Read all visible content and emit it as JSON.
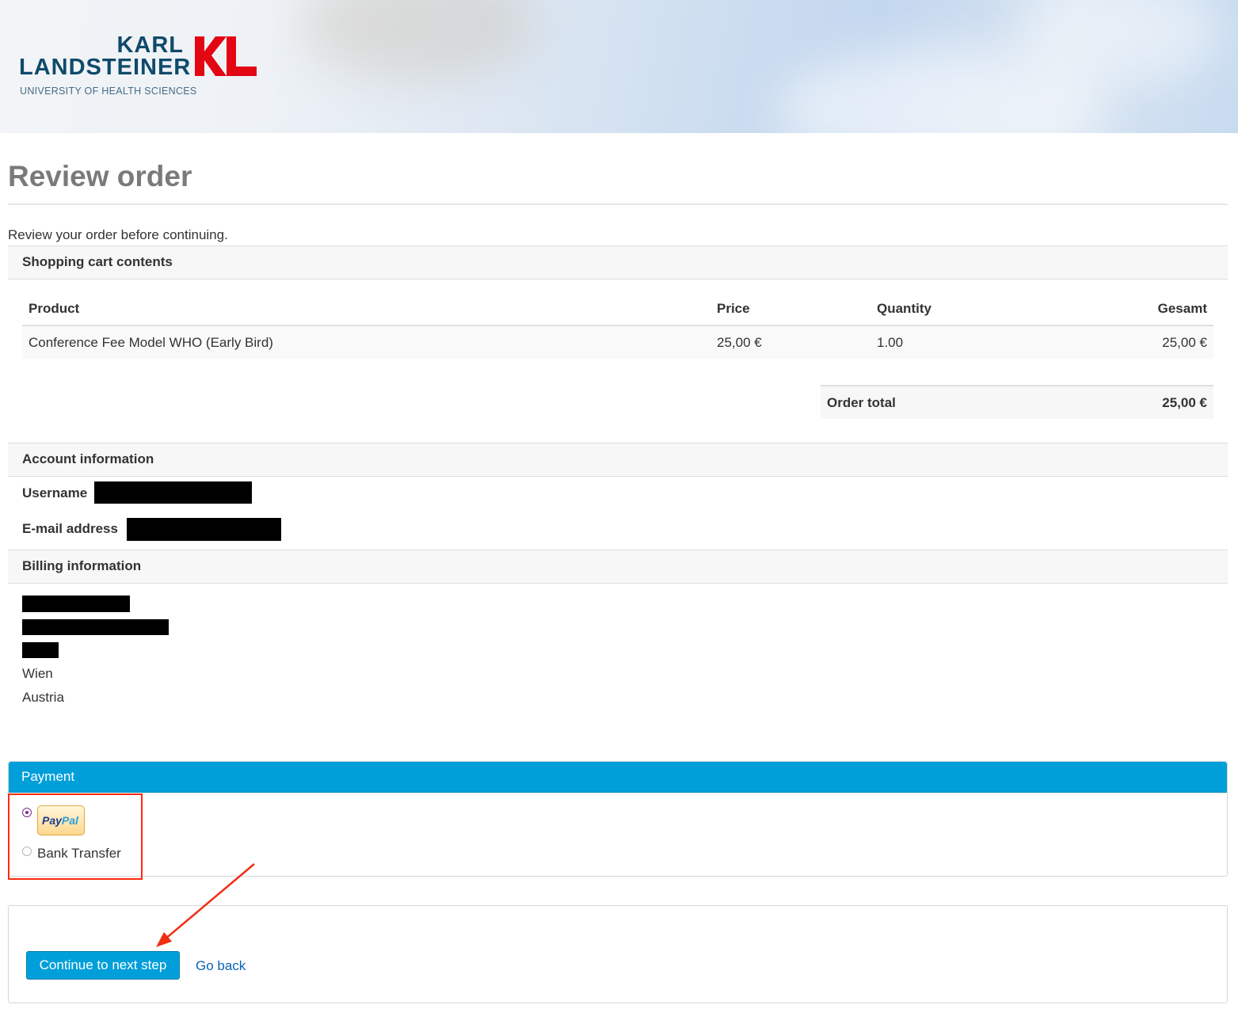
{
  "brand": {
    "line1": "KARL",
    "line2": "LANDSTEINER",
    "line3": "UNIVERSITY OF HEALTH SCIENCES",
    "mark": "KL",
    "colors": {
      "navy": "#0f4a6b",
      "red": "#e30613"
    }
  },
  "page": {
    "title": "Review order",
    "intro": "Review your order before continuing."
  },
  "cart": {
    "heading": "Shopping cart contents",
    "columns": {
      "product": "Product",
      "price": "Price",
      "quantity": "Quantity",
      "total": "Gesamt"
    },
    "rows": [
      {
        "product": "Conference Fee Model WHO (Early Bird)",
        "price": "25,00 €",
        "quantity": "1.00",
        "total": "25,00 €"
      }
    ],
    "order_total_label": "Order total",
    "order_total_value": "25,00 €"
  },
  "account": {
    "heading": "Account information",
    "username_label": "Username",
    "email_label": "E-mail address"
  },
  "billing": {
    "heading": "Billing information",
    "city": "Wien",
    "country": "Austria"
  },
  "payment": {
    "heading": "Payment",
    "options": [
      {
        "label": "PayPal",
        "selected": true,
        "icon": "paypal-logo"
      },
      {
        "label": "Bank Transfer",
        "selected": false
      }
    ],
    "accent": "#009fda"
  },
  "actions": {
    "continue_label": "Continue to next step",
    "back_label": "Go back"
  }
}
